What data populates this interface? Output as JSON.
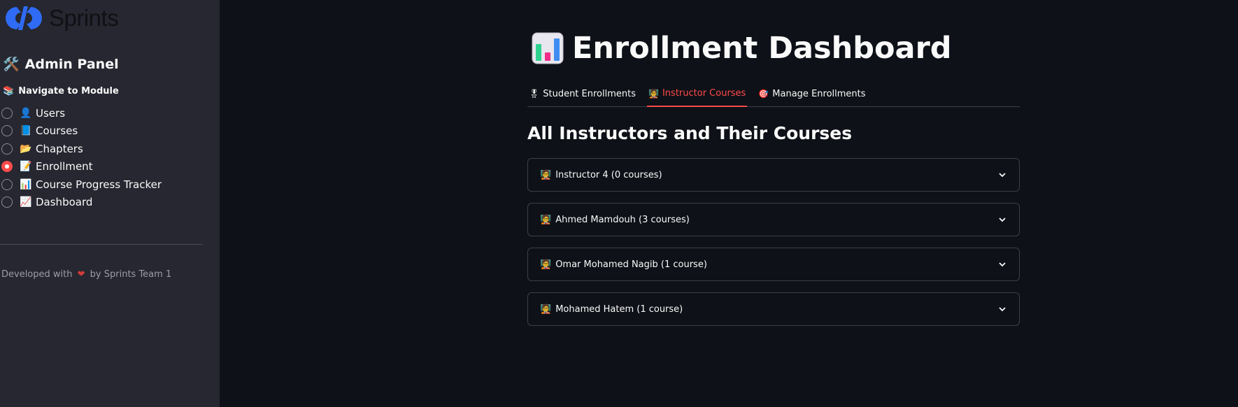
{
  "sidebar": {
    "logo_text": "Sprints",
    "admin_title": "Admin Panel",
    "admin_icon": "tools-icon",
    "nav_label": "Navigate to Module",
    "nav_icon": "books-icon",
    "items": [
      {
        "label": "Users",
        "emoji": "👤",
        "checked": false
      },
      {
        "label": "Courses",
        "emoji": "📘",
        "checked": false
      },
      {
        "label": "Chapters",
        "emoji": "📂",
        "checked": false
      },
      {
        "label": "Enrollment",
        "emoji": "📝",
        "checked": true
      },
      {
        "label": "Course Progress Tracker",
        "emoji": "📊",
        "checked": false
      },
      {
        "label": "Dashboard",
        "emoji": "📈",
        "checked": false
      }
    ],
    "footer": {
      "prefix": "Developed with",
      "suffix": "by Sprints Team 1"
    }
  },
  "main": {
    "title": "Enrollment Dashboard",
    "tabs": [
      {
        "label": "Student Enrollments",
        "emoji": "🎖",
        "active": false
      },
      {
        "label": "Instructor Courses",
        "emoji": "🧑‍🏫",
        "active": true
      },
      {
        "label": "Manage Enrollments",
        "emoji": "🎯",
        "active": false
      }
    ],
    "section_title": "All Instructors and Their Courses",
    "expanders": [
      {
        "label": "Instructor 4 (0 courses)"
      },
      {
        "label": "Ahmed Mamdouh (3 courses)"
      },
      {
        "label": "Omar Mohamed Nagib (1 course)"
      },
      {
        "label": "Mohamed Hatem (1 course)"
      }
    ]
  },
  "colors": {
    "background": "#0e1117",
    "sidebar": "#262730",
    "accent": "#ff4b4b",
    "logo_blue": "#2f6bf5",
    "text": "#fafafa",
    "border": "#3d3f4a"
  }
}
